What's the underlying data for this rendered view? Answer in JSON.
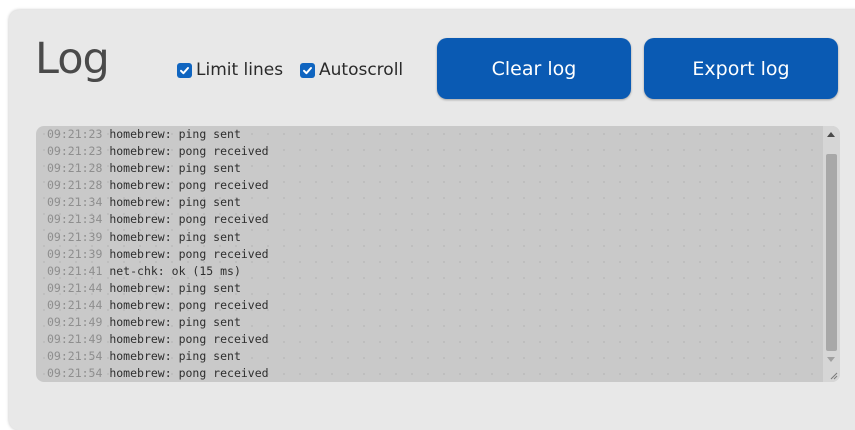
{
  "header": {
    "title": "Log",
    "options": {
      "limit_lines": {
        "label": "Limit lines",
        "checked": true
      },
      "autoscroll": {
        "label": "Autoscroll",
        "checked": true
      }
    },
    "buttons": {
      "clear": "Clear log",
      "export": "Export log"
    }
  },
  "log": {
    "lines": [
      {
        "time": "09:21:23",
        "msg": "homebrew: ping sent"
      },
      {
        "time": "09:21:23",
        "msg": "homebrew: pong received"
      },
      {
        "time": "09:21:28",
        "msg": "homebrew: ping sent"
      },
      {
        "time": "09:21:28",
        "msg": "homebrew: pong received"
      },
      {
        "time": "09:21:34",
        "msg": "homebrew: ping sent"
      },
      {
        "time": "09:21:34",
        "msg": "homebrew: pong received"
      },
      {
        "time": "09:21:39",
        "msg": "homebrew: ping sent"
      },
      {
        "time": "09:21:39",
        "msg": "homebrew: pong received"
      },
      {
        "time": "09:21:41",
        "msg": "net-chk: ok (15 ms)"
      },
      {
        "time": "09:21:44",
        "msg": "homebrew: ping sent"
      },
      {
        "time": "09:21:44",
        "msg": "homebrew: pong received"
      },
      {
        "time": "09:21:49",
        "msg": "homebrew: ping sent"
      },
      {
        "time": "09:21:49",
        "msg": "homebrew: pong received"
      },
      {
        "time": "09:21:54",
        "msg": "homebrew: ping sent"
      },
      {
        "time": "09:21:54",
        "msg": "homebrew: pong received"
      }
    ]
  },
  "colors": {
    "button": "#0a5ab3",
    "checkbox": "#1065c0",
    "panel": "#e8e8e8",
    "log_background": "#c9c9c9"
  },
  "icons": {
    "checkbox": "check-icon",
    "scroll_up": "arrow-up-icon",
    "scroll_down": "arrow-down-icon",
    "resize": "resize-grip-icon"
  }
}
